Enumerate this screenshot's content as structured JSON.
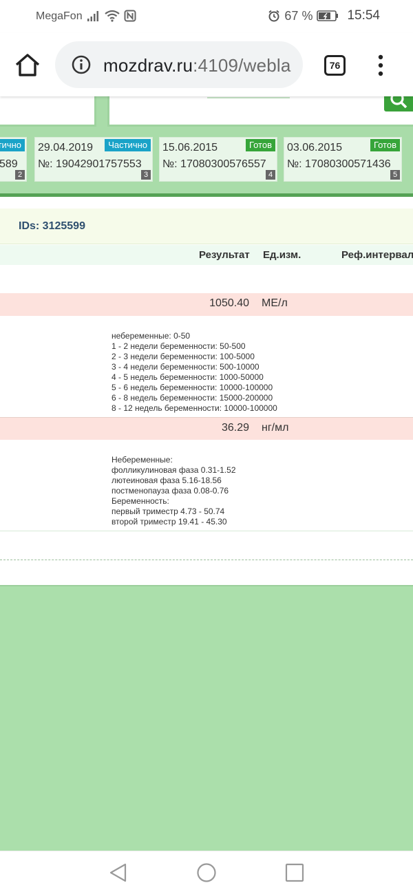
{
  "status_bar": {
    "carrier": "MegaFon",
    "battery": "67 %",
    "time": "15:54"
  },
  "browser": {
    "url_host": "mozdrav.ru",
    "url_rest": ":4109/webla",
    "tab_count": "76"
  },
  "orders": [
    {
      "date": "",
      "number": "589",
      "status": "астично",
      "status_type": "partial",
      "index": "2"
    },
    {
      "date": "29.04.2019",
      "number": "№: 19042901757553",
      "status": "Частично",
      "status_type": "partial",
      "index": "3"
    },
    {
      "date": "15.06.2015",
      "number": "№: 17080300576557",
      "status": "Готов",
      "status_type": "ready",
      "index": "4"
    },
    {
      "date": "03.06.2015",
      "number": "№: 17080300571436",
      "status": "Готов",
      "status_type": "ready",
      "index": "5"
    }
  ],
  "ids_label": "IDs: 3125599",
  "table": {
    "headers": {
      "result": "Результат",
      "unit": "Ед.изм.",
      "ref": "Реф.интервал"
    },
    "rows": [
      {
        "result": "1050.40",
        "unit": "МЕ/л",
        "reference": [
          "небеременные: 0-50",
          "1 - 2 недели беременности: 50-500",
          "2 - 3 недели беременности: 100-5000",
          "3 - 4 недели беременности: 500-10000",
          "4 - 5 недель беременности: 1000-50000",
          "5 - 6 недель беременности: 10000-100000",
          "6 - 8 недель беременности: 15000-200000",
          "8 - 12 недель беременности: 10000-100000"
        ]
      },
      {
        "result": "36.29",
        "unit": "нг/мл",
        "reference": [
          "Небеременные:",
          "фолликулиновая фаза 0.31-1.52",
          "лютеиновая фаза 5.16-18.56",
          "постменопауза фаза 0.08-0.76",
          "Беременность:",
          "первый триместр 4.73 - 50.74",
          "второй триместр 19.41 - 45.30"
        ]
      }
    ]
  },
  "colors": {
    "green_bg": "#a9dca9",
    "badge_partial": "#1aa3c8",
    "badge_ready": "#37a53a",
    "row_highlight": "#fde2dd"
  }
}
